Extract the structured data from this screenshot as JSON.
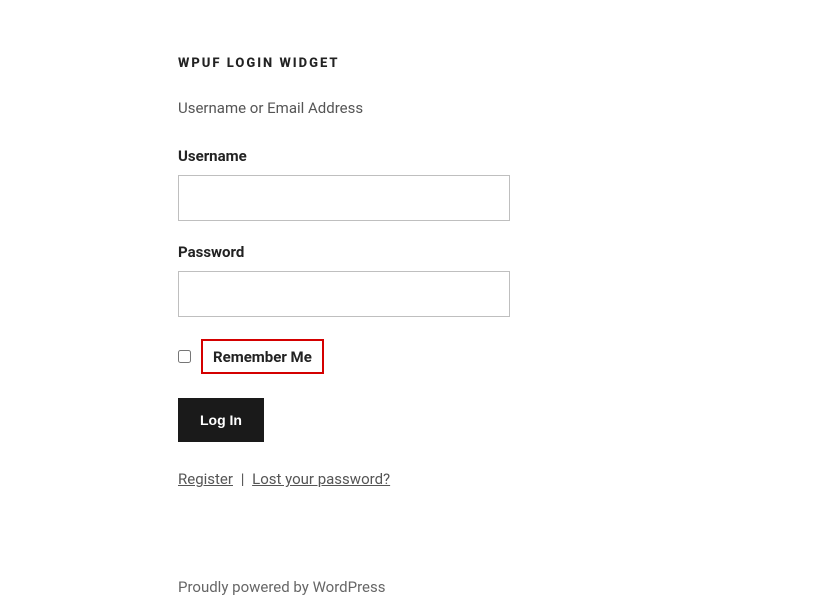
{
  "widget": {
    "title": "WPUF LOGIN WIDGET",
    "subtitle": "Username or Email Address",
    "username": {
      "label": "Username",
      "value": ""
    },
    "password": {
      "label": "Password",
      "value": ""
    },
    "remember": {
      "label": "Remember Me"
    },
    "login_button": "Log In",
    "links": {
      "register": "Register",
      "separator": "|",
      "lost_password": "Lost your password?"
    }
  },
  "footer": {
    "text": "Proudly powered by WordPress"
  }
}
